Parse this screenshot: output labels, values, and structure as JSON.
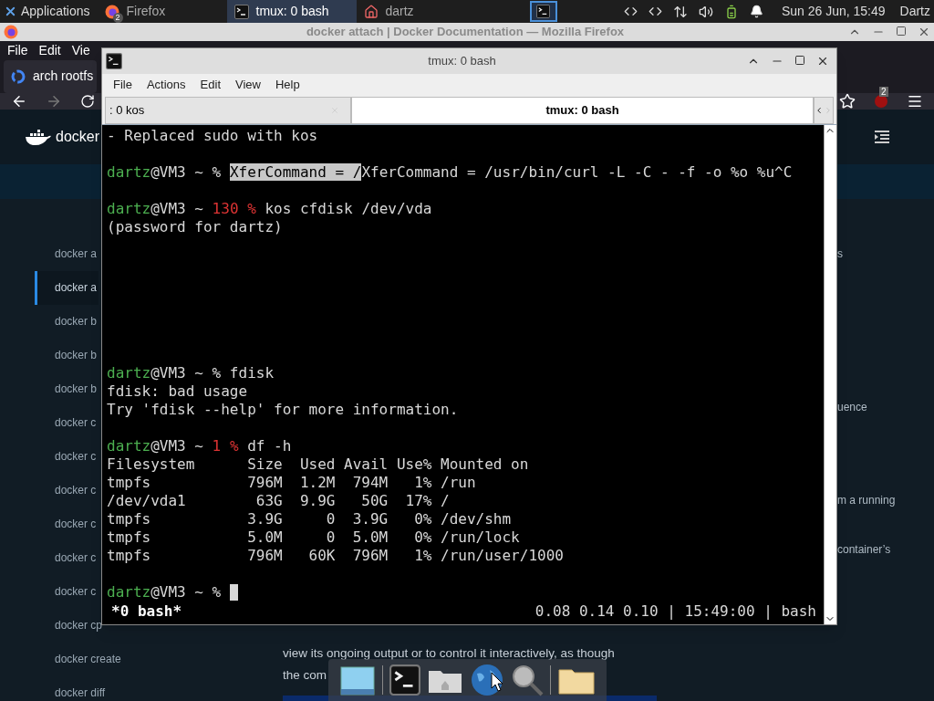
{
  "panel": {
    "apps_menu": "Applications",
    "tasks": [
      {
        "kind": "firefox",
        "label": "Firefox",
        "badge": "2",
        "selected": false
      },
      {
        "kind": "terminal",
        "label": "tmux: 0 bash",
        "selected": true
      },
      {
        "kind": "home",
        "label": "dartz",
        "selected": false
      }
    ],
    "clock": "Sun 26 Jun, 15:49",
    "user": "Dartz"
  },
  "firefox": {
    "title": "docker attach | Docker Documentation — Mozilla Firefox",
    "menu": [
      "File",
      "Edit",
      "Vie"
    ],
    "tab": "arch rootfs",
    "addon_badge": "2",
    "page": {
      "logo": "docker",
      "sidebar": [
        {
          "label": "docker a",
          "selected": false
        },
        {
          "label": "docker a",
          "selected": true
        },
        {
          "label": "docker b",
          "selected": false
        },
        {
          "label": "docker b",
          "selected": false
        },
        {
          "label": "docker b",
          "selected": false
        },
        {
          "label": "docker c",
          "selected": false
        },
        {
          "label": "docker c",
          "selected": false
        },
        {
          "label": "docker c",
          "selected": false
        },
        {
          "label": "docker c",
          "selected": false
        },
        {
          "label": "docker c",
          "selected": false
        },
        {
          "label": "docker c",
          "selected": false
        },
        {
          "label": "docker cp",
          "selected": false
        },
        {
          "label": "docker create",
          "selected": false
        },
        {
          "label": "docker diff",
          "selected": false
        }
      ],
      "right_texts": [
        "s",
        "uence",
        "m a running",
        "container’s"
      ],
      "body_lines": [
        "view its ongoing output or to control it interactively, as though",
        "the com"
      ]
    }
  },
  "terminal": {
    "title": "tmux: 0 bash",
    "menu": [
      "File",
      "Actions",
      "Edit",
      "View",
      "Help"
    ],
    "tabs": [
      {
        "label": ": 0 kos",
        "selected": false
      },
      {
        "label": "tmux: 0 bash",
        "selected": true
      }
    ],
    "lines": [
      {
        "kind": "text",
        "spans": [
          {
            "text": "- Replaced sudo with kos",
            "kind": "plain"
          }
        ]
      },
      {
        "kind": "blank"
      },
      {
        "kind": "text",
        "spans": [
          {
            "text": "dartz",
            "kind": "user"
          },
          {
            "text": "@VM3 ~ % ",
            "kind": "plain"
          },
          {
            "text": "XferCommand = /",
            "kind": "selection"
          },
          {
            "text": "XferCommand = /usr/bin/curl -L -C - -f -o %o %u^C",
            "kind": "plain"
          }
        ]
      },
      {
        "kind": "blank"
      },
      {
        "kind": "text",
        "spans": [
          {
            "text": "dartz",
            "kind": "user"
          },
          {
            "text": "@VM3 ~ ",
            "kind": "plain"
          },
          {
            "text": "130 %",
            "kind": "error"
          },
          {
            "text": " kos cfdisk /dev/vda",
            "kind": "plain"
          }
        ]
      },
      {
        "kind": "text",
        "spans": [
          {
            "text": "(password for dartz)",
            "kind": "plain"
          }
        ]
      },
      {
        "kind": "blank"
      },
      {
        "kind": "blank"
      },
      {
        "kind": "blank"
      },
      {
        "kind": "blank"
      },
      {
        "kind": "blank"
      },
      {
        "kind": "blank"
      },
      {
        "kind": "blank"
      },
      {
        "kind": "text",
        "spans": [
          {
            "text": "dartz",
            "kind": "user"
          },
          {
            "text": "@VM3 ~ % fdisk",
            "kind": "plain"
          }
        ]
      },
      {
        "kind": "text",
        "spans": [
          {
            "text": "fdisk: bad usage",
            "kind": "plain"
          }
        ]
      },
      {
        "kind": "text",
        "spans": [
          {
            "text": "Try 'fdisk --help' for more information.",
            "kind": "plain"
          }
        ]
      },
      {
        "kind": "blank"
      },
      {
        "kind": "text",
        "spans": [
          {
            "text": "dartz",
            "kind": "user"
          },
          {
            "text": "@VM3 ~ ",
            "kind": "plain"
          },
          {
            "text": "1 %",
            "kind": "error"
          },
          {
            "text": " df -h",
            "kind": "plain"
          }
        ]
      },
      {
        "kind": "text",
        "spans": [
          {
            "text": "Filesystem      Size  Used Avail Use% Mounted on",
            "kind": "plain"
          }
        ]
      },
      {
        "kind": "text",
        "spans": [
          {
            "text": "tmpfs           796M  1.2M  794M   1% /run",
            "kind": "plain"
          }
        ]
      },
      {
        "kind": "text",
        "spans": [
          {
            "text": "/dev/vda1        63G  9.9G   50G  17% /",
            "kind": "plain"
          }
        ]
      },
      {
        "kind": "text",
        "spans": [
          {
            "text": "tmpfs           3.9G     0  3.9G   0% /dev/shm",
            "kind": "plain"
          }
        ]
      },
      {
        "kind": "text",
        "spans": [
          {
            "text": "tmpfs           5.0M     0  5.0M   0% /run/lock",
            "kind": "plain"
          }
        ]
      },
      {
        "kind": "text",
        "spans": [
          {
            "text": "tmpfs           796M   60K  796M   1% /run/user/1000",
            "kind": "plain"
          }
        ]
      },
      {
        "kind": "blank"
      },
      {
        "kind": "text",
        "cursor": true,
        "spans": [
          {
            "text": "dartz",
            "kind": "user"
          },
          {
            "text": "@VM3 ~ % ",
            "kind": "plain"
          }
        ]
      }
    ],
    "status_left": "*0 bash*",
    "status_right": "0.08 0.14 0.10 | 15:49:00 | bash"
  }
}
